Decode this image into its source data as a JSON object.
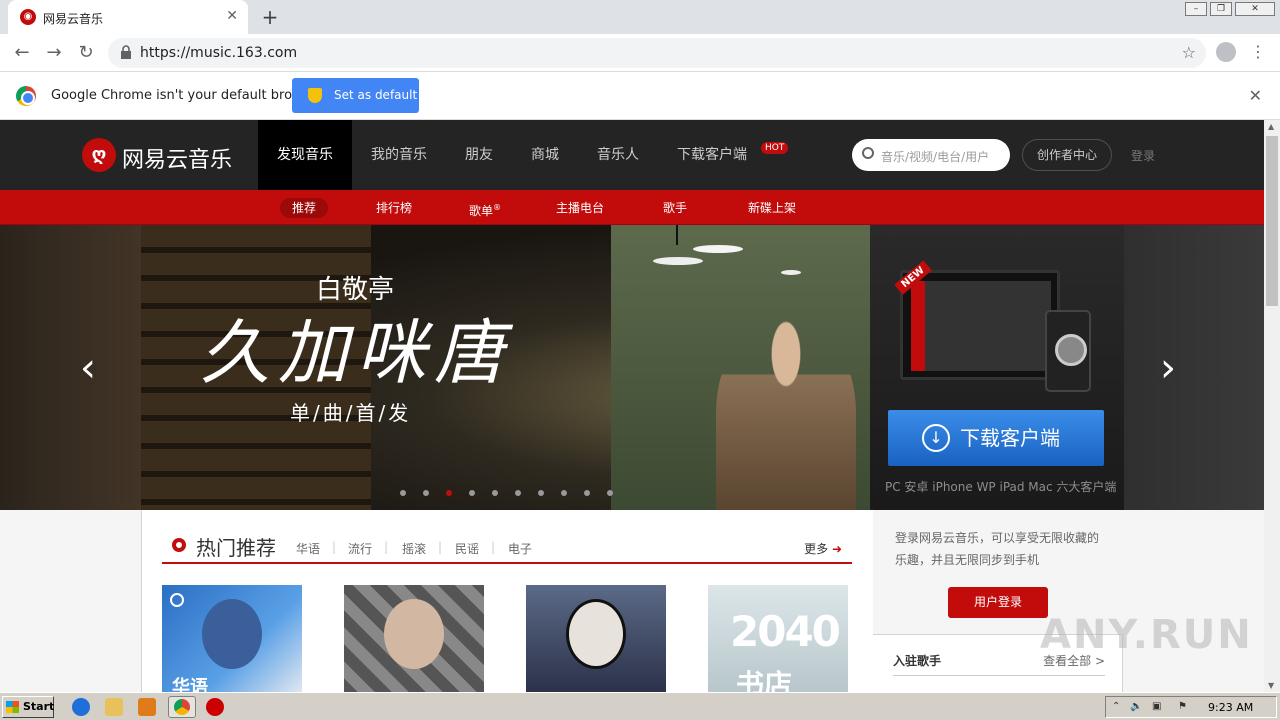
{
  "browser": {
    "tab_title": "网易云音乐",
    "tab_favicon": "netease-music-favicon",
    "url": "https://music.163.com",
    "infobar_message": "Google Chrome isn't your default browser",
    "set_default_label": "Set as default"
  },
  "site": {
    "logo_text": "网易云音乐",
    "top_nav": [
      "发现音乐",
      "我的音乐",
      "朋友",
      "商城",
      "音乐人",
      "下载客户端"
    ],
    "hot_badge": "HOT",
    "search_placeholder": "音乐/视频/电台/用户",
    "creator_center": "创作者中心",
    "login": "登录",
    "sub_nav": [
      "推荐",
      "排行榜",
      "歌单",
      "主播电台",
      "歌手",
      "新碟上架"
    ],
    "sub_nav_reg_mark": "®",
    "banner": {
      "artist": "白敬亭",
      "song": "久加咪唐",
      "release": "单/曲/首/发",
      "dot_count": 10,
      "active_dot": 2
    },
    "download": {
      "new_tag": "NEW",
      "button": "下载客户端",
      "platforms": "PC 安卓 iPhone WP iPad Mac 六大客户端"
    },
    "hot_recommend": {
      "title": "热门推荐",
      "categories": [
        "华语",
        "流行",
        "摇滚",
        "民谣",
        "电子"
      ],
      "more": "更多",
      "cover1_label": "华语",
      "cover4_text": "2040",
      "cover4_text2": "书店"
    },
    "login_panel": {
      "text": "登录网易云音乐，可以享受无限收藏的乐趣，并且无限同步到手机",
      "button": "用户登录"
    },
    "artists": {
      "title": "入驻歌手",
      "view_all": "查看全部 >"
    },
    "watermark": "ANY.RUN"
  },
  "taskbar": {
    "start": "Start",
    "time": "9:23 AM"
  },
  "colors": {
    "brand_red": "#c20c0c",
    "nav_dark": "#242424",
    "chrome_blue": "#4285f4"
  }
}
